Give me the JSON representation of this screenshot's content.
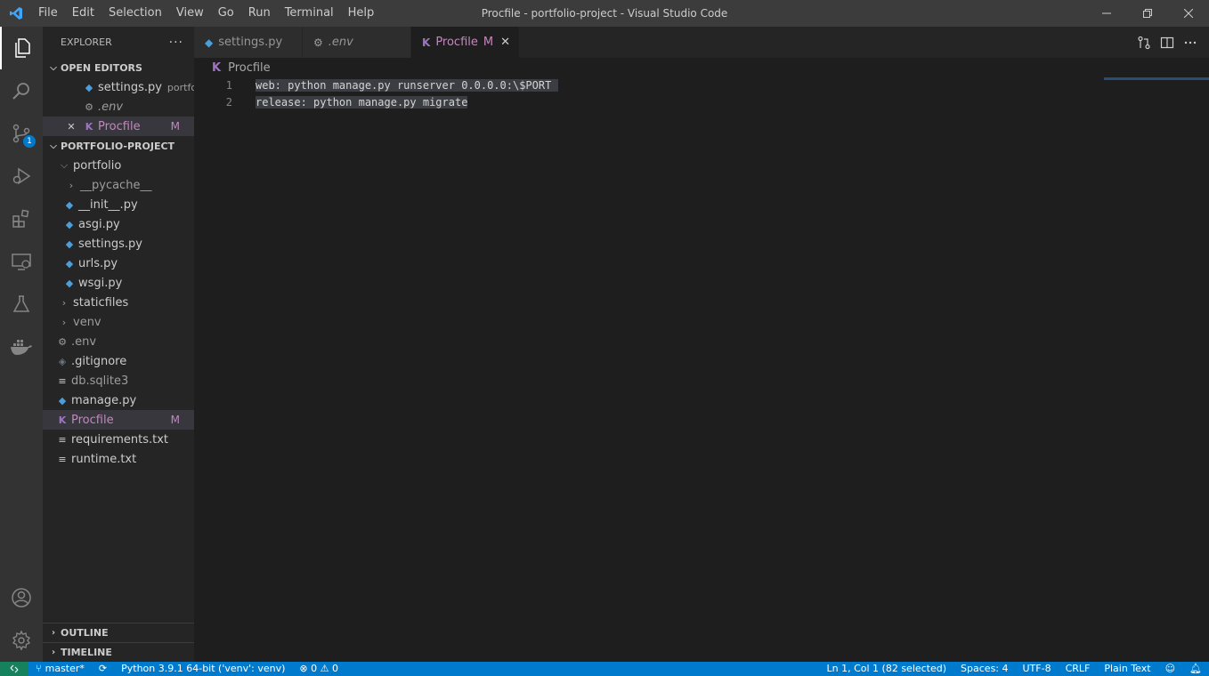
{
  "window": {
    "title": "Procfile - portfolio-project - Visual Studio Code"
  },
  "menu": [
    "File",
    "Edit",
    "Selection",
    "View",
    "Go",
    "Run",
    "Terminal",
    "Help"
  ],
  "activity_bar": {
    "source_control_badge": "1"
  },
  "sidebar": {
    "title": "EXPLORER",
    "more": "···",
    "open_editors": {
      "label": "OPEN EDITORS",
      "items": [
        {
          "name": "settings.py",
          "description": "portfolio"
        },
        {
          "name": ".env"
        },
        {
          "name": "Procfile",
          "status": "M"
        }
      ]
    },
    "project": {
      "label": "PORTFOLIO-PROJECT",
      "tree": [
        {
          "name": "portfolio"
        },
        {
          "name": "__pycache__"
        },
        {
          "name": "__init__.py"
        },
        {
          "name": "asgi.py"
        },
        {
          "name": "settings.py"
        },
        {
          "name": "urls.py"
        },
        {
          "name": "wsgi.py"
        },
        {
          "name": "staticfiles"
        },
        {
          "name": "venv"
        },
        {
          "name": ".env"
        },
        {
          "name": ".gitignore"
        },
        {
          "name": "db.sqlite3"
        },
        {
          "name": "manage.py"
        },
        {
          "name": "Procfile",
          "status": "M"
        },
        {
          "name": "requirements.txt"
        },
        {
          "name": "runtime.txt"
        }
      ]
    },
    "outline_label": "OUTLINE",
    "timeline_label": "TIMELINE"
  },
  "tabs": [
    {
      "label": "settings.py"
    },
    {
      "label": ".env"
    },
    {
      "label": "Procfile",
      "status": "M"
    }
  ],
  "breadcrumb": "Procfile",
  "editor": {
    "lines": [
      {
        "num": "1",
        "text": "web: python manage.py runserver 0.0.0.0:\\$PORT "
      },
      {
        "num": "2",
        "text": "release: python manage.py migrate"
      }
    ]
  },
  "statusbar": {
    "branch": "master*",
    "interpreter": "Python 3.9.1 64-bit ('venv': venv)",
    "problems": "⊗ 0 ⚠ 0",
    "position": "Ln 1, Col 1 (82 selected)",
    "spaces": "Spaces: 4",
    "encoding": "UTF-8",
    "eol": "CRLF",
    "language": "Plain Text"
  },
  "colors": {
    "accent": "#007acc",
    "modified": "#c586c0",
    "python": "#4b9ed8"
  }
}
